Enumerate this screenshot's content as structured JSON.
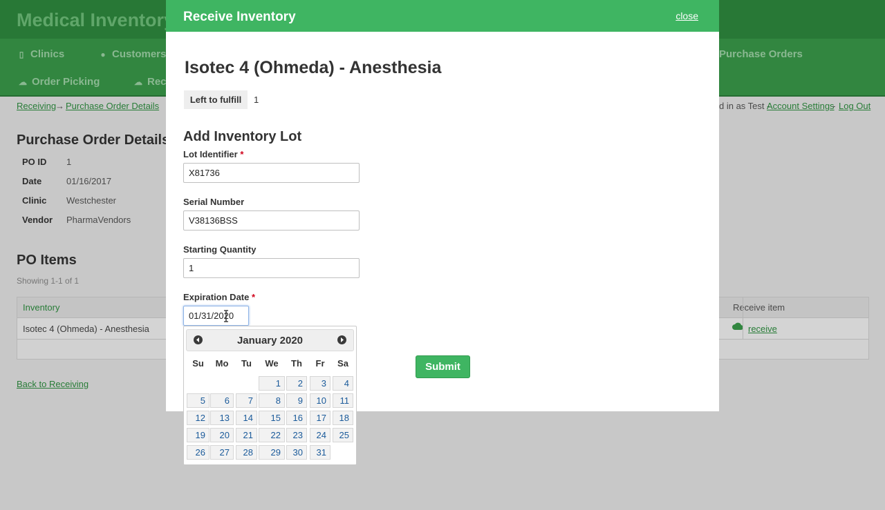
{
  "app": {
    "title": "Medical Inventory",
    "nav": [
      {
        "label": "Clinics",
        "icon": "hospital-icon"
      },
      {
        "label": "Customers",
        "icon": "users-icon"
      },
      {
        "label": "Purchase Orders",
        "icon": "file-icon"
      },
      {
        "label": "Order Picking",
        "icon": "cloud-upload-icon"
      },
      {
        "label": "Rec",
        "icon": "cloud-download-icon"
      }
    ],
    "breadcrumb": {
      "first": "Receiving",
      "arrow": "→",
      "second": "Purchase Order Details"
    },
    "account": {
      "logged_in_text": "d in as Test -",
      "account_settings": "Account Settings",
      "separator": "-",
      "logout": "Log Out"
    }
  },
  "po_details": {
    "heading": "Purchase Order Details",
    "fields": [
      {
        "label": "PO ID",
        "value": "1"
      },
      {
        "label": "Date",
        "value": "01/16/2017"
      },
      {
        "label": "Clinic",
        "value": "Westchester"
      },
      {
        "label": "Vendor",
        "value": "PharmaVendors"
      }
    ]
  },
  "po_items": {
    "heading": "PO Items",
    "showing": "Showing 1-1 of 1",
    "columns": {
      "inventory": "Inventory",
      "receive": "Receive item"
    },
    "rows": [
      {
        "inventory": "Isotec 4 (Ohmeda) - Anesthesia",
        "action": "receive"
      }
    ],
    "back_link": "Back to Receiving"
  },
  "modal": {
    "title": "Receive Inventory",
    "close": "close",
    "item_title": "Isotec 4 (Ohmeda) - Anesthesia",
    "left_to_fulfill_label": "Left to fulfill",
    "left_to_fulfill_value": "1",
    "section_title": "Add Inventory Lot",
    "fields": {
      "lot": {
        "label": "Lot Identifier",
        "required": "*",
        "value": "X81736"
      },
      "serial": {
        "label": "Serial Number",
        "value": "V38136BSS"
      },
      "quantity": {
        "label": "Starting Quantity",
        "value": "1"
      },
      "expiration": {
        "label": "Expiration Date",
        "required": "*",
        "value": "01/31/2020"
      }
    },
    "submit": "Submit"
  },
  "datepicker": {
    "month_label": "January 2020",
    "weekdays": [
      "Su",
      "Mo",
      "Tu",
      "We",
      "Th",
      "Fr",
      "Sa"
    ],
    "first_weekday_index": 3,
    "days_in_month": 31
  },
  "colors": {
    "header_green": "#2f8a3e",
    "modal_green": "#3fb562",
    "link_green": "#2e8f40",
    "required_red": "#d0021b",
    "day_blue": "#1a5a9a"
  }
}
